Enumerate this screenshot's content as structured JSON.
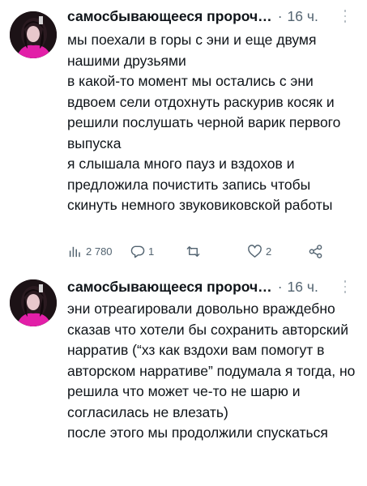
{
  "posts": [
    {
      "author": "самосбывающееся пророч…",
      "separator": "·",
      "time": "16 ч.",
      "lines": [
        "мы поехали в горы с эни и еще двумя нашими друзьями",
        "в какой-то момент мы остались с эни вдвоем сели отдохнуть раскурив косяк и решили послушать черной варик первого выпуска",
        "я слышала много пауз и вздохов и предложила почистить запись чтобы скинуть немного звуковиковской работы"
      ],
      "actions": {
        "views": "2 780",
        "replies": "1",
        "reposts": "",
        "likes": "2"
      }
    },
    {
      "author": "самосбывающееся пророч…",
      "separator": "·",
      "time": "16 ч.",
      "lines": [
        "эни отреагировали довольно враждебно сказав что хотели бы сохранить авторский нарратив (“хз как вздохи вам помогут в авторском нарративе” подумала я тогда, но решила что может че-то не шарю и согласилась не влезать)",
        "после этого мы продолжили спускаться"
      ]
    }
  ],
  "colors": {
    "text": "#0f1419",
    "muted": "#536471",
    "avatar_accent": "#e21fa8"
  },
  "icons": [
    "more-icon",
    "views-icon",
    "reply-icon",
    "repost-icon",
    "like-icon",
    "share-icon"
  ]
}
